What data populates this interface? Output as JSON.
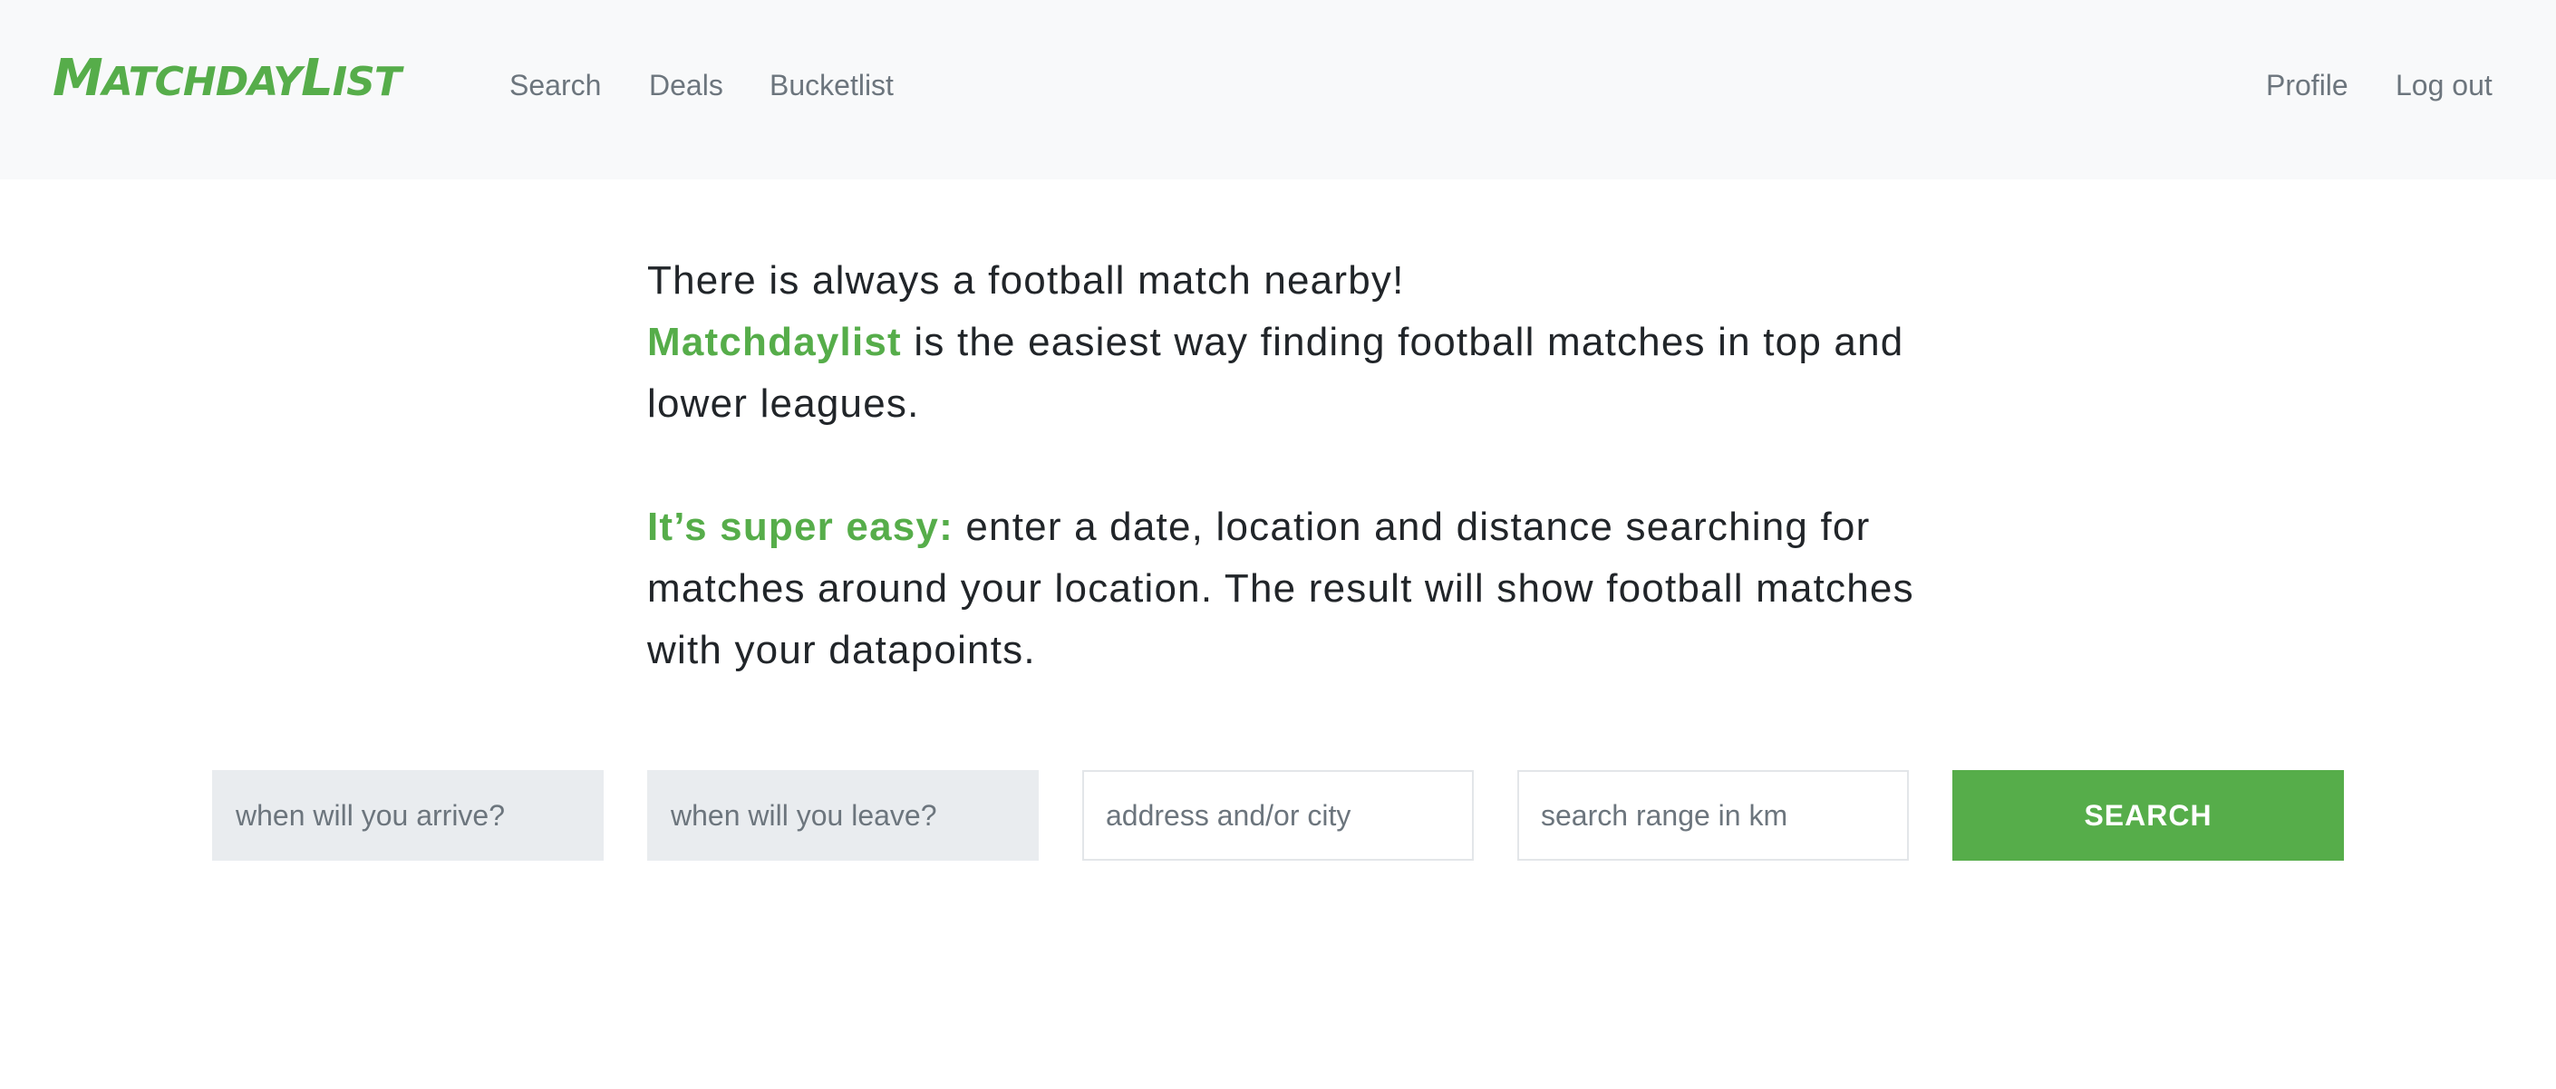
{
  "navbar": {
    "logo": {
      "text": "M",
      "small1": "ATCHDAY",
      "big2": "L",
      "small2": "IST"
    },
    "links_left": [
      "Search",
      "Deals",
      "Bucketlist"
    ],
    "links_right": [
      "Profile",
      "Log out"
    ]
  },
  "intro": {
    "line1": "There is always a football match nearby!",
    "brand": "Matchdaylist",
    "line2_rest": " is the easiest way finding football matches in top and lower leagues.",
    "easy_label": "It’s super easy:",
    "easy_rest": " enter a date, location and distance searching for matches around your location. The result will show football matches with your datapoints."
  },
  "search_form": {
    "arrive_placeholder": "when will you arrive?",
    "leave_placeholder": "when will you leave?",
    "address_placeholder": "address and/or city",
    "range_placeholder": "search range in km",
    "button_label": "SEARCH"
  },
  "colors": {
    "brand_green": "#56ad4a",
    "navbar_bg": "#f8f9fa",
    "muted_text": "#6c757d",
    "body_text": "#212529"
  }
}
